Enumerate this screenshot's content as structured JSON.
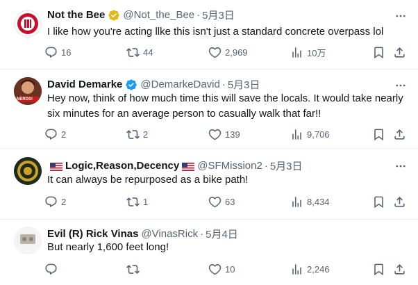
{
  "replies": [
    {
      "name": "Not the Bee",
      "handle": "@Not_the_Bee",
      "dot": "·",
      "time": "5月3日",
      "text": "I like how you're acting llke this isn't just a standard concrete overpass lol",
      "replies": "16",
      "reposts": "44",
      "likes": "2,969",
      "views": "10万",
      "verified": "gold"
    },
    {
      "name": "David Demarke",
      "handle": "@DemarkeDavid",
      "dot": "·",
      "time": "5月3日",
      "text": "Hey now, think of how much time this will save the locals.  It would take nearly six minutes for an average person to casually walk that far!!",
      "replies": "2",
      "reposts": "2",
      "likes": "139",
      "views": "9,706",
      "verified": "blue",
      "avatar_text": "NERDS!"
    },
    {
      "name": "Logic,Reason,Decency",
      "handle": "@SFMission2",
      "dot": "·",
      "time": "5月3日",
      "text": "It can always be repurposed as a bike path!",
      "replies": "2",
      "reposts": "1",
      "likes": "63",
      "views": "8,434"
    },
    {
      "name": "Evil (R) Rick Vinas",
      "handle": "@VinasRick",
      "dot": "·",
      "time": "5月4日",
      "text": "But nearly 1,600 feet long!",
      "replies": "",
      "reposts": "",
      "likes": "10",
      "views": "2,246"
    }
  ],
  "icons": {
    "reply": "reply-icon",
    "repost": "repost-icon",
    "like": "heart-icon",
    "views": "views-icon",
    "bookmark": "bookmark-icon",
    "share": "share-icon",
    "more": "more-icon"
  },
  "colors": {
    "text": "#0f1419",
    "secondary": "#536471",
    "gold": "#e2b719",
    "blue": "#1d9bf0",
    "divider": "#eff3f4"
  }
}
